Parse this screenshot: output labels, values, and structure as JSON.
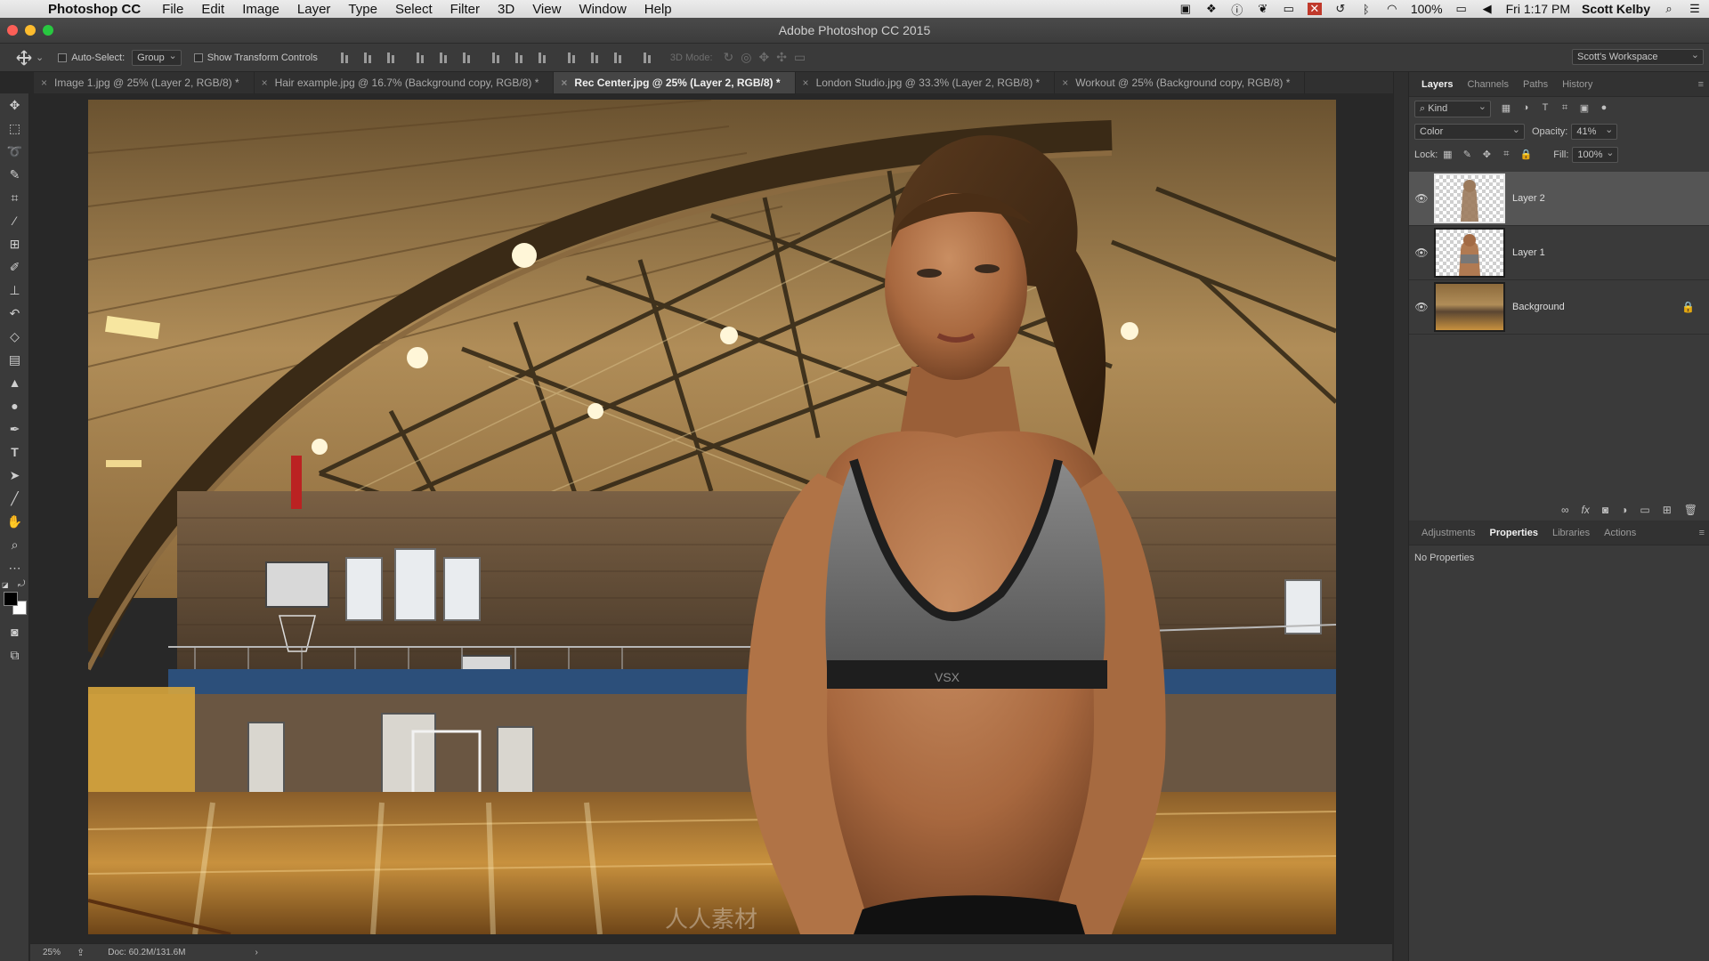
{
  "menubar": {
    "app": "Photoshop CC",
    "items": [
      "File",
      "Edit",
      "Image",
      "Layer",
      "Type",
      "Select",
      "Filter",
      "3D",
      "View",
      "Window",
      "Help"
    ],
    "battery": "100%",
    "clock": "Fri 1:17 PM",
    "user": "Scott Kelby"
  },
  "window": {
    "title": "Adobe Photoshop CC 2015"
  },
  "options": {
    "auto_select_label": "Auto-Select:",
    "auto_select_value": "Group",
    "transform_label": "Show Transform Controls",
    "mode3d_label": "3D Mode:",
    "workspace": "Scott's Workspace"
  },
  "doc_tabs": [
    {
      "label": "Image 1.jpg @ 25% (Layer 2, RGB/8) *",
      "active": false
    },
    {
      "label": "Hair example.jpg @ 16.7% (Background copy, RGB/8) *",
      "active": false
    },
    {
      "label": "Rec Center.jpg @ 25% (Layer 2, RGB/8) *",
      "active": true
    },
    {
      "label": "London Studio.jpg @ 33.3% (Layer 2, RGB/8) *",
      "active": false
    },
    {
      "label": "Workout @ 25% (Background copy, RGB/8) *",
      "active": false
    }
  ],
  "status": {
    "zoom": "25%",
    "doc": "Doc: 60.2M/131.6M"
  },
  "layers_panel": {
    "tabs": [
      "Layers",
      "Channels",
      "Paths",
      "History"
    ],
    "kind": "Kind",
    "blend_mode": "Color",
    "opacity_label": "Opacity:",
    "opacity_value": "41%",
    "lock_label": "Lock:",
    "fill_label": "Fill:",
    "fill_value": "100%",
    "layers": [
      {
        "name": "Layer 2",
        "selected": true,
        "locked": false
      },
      {
        "name": "Layer 1",
        "selected": false,
        "locked": false
      },
      {
        "name": "Background",
        "selected": false,
        "locked": true
      }
    ]
  },
  "properties_panel": {
    "tabs": [
      "Adjustments",
      "Properties",
      "Libraries",
      "Actions"
    ],
    "message": "No Properties"
  },
  "canvas": {
    "top_brand": "VSX",
    "watermark": "人人素材"
  },
  "colors": {
    "accent_active_tab": "#454545",
    "selected_layer": "#555555",
    "close_button": "#fc5f57",
    "minimize_button": "#fdbc2e",
    "zoom_button": "#28c840"
  }
}
